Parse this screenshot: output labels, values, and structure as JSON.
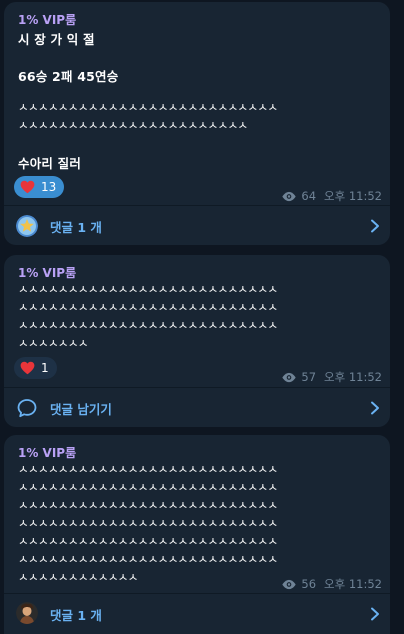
{
  "posts": [
    {
      "channel": "1% VIP룸",
      "lines": [
        "시 장 가 익 절",
        "66승 2패 45연승",
        "수아리 질러"
      ],
      "ah_lines": [
        "ㅅㅅㅅㅅㅅㅅㅅㅅㅅㅅㅅㅅㅅㅅㅅㅅㅅㅅㅅㅅㅅㅅㅅㅅㅅㅅ",
        "ㅅㅅㅅㅅㅅㅅㅅㅅㅅㅅㅅㅅㅅㅅㅅㅅㅅㅅㅅㅅㅅㅅㅅ"
      ],
      "reaction_count": "13",
      "views": "64",
      "time": "오후 11:52",
      "comments_label": "댓글 1 개"
    },
    {
      "channel": "1% VIP룸",
      "ah_lines": [
        "ㅅㅅㅅㅅㅅㅅㅅㅅㅅㅅㅅㅅㅅㅅㅅㅅㅅㅅㅅㅅㅅㅅㅅㅅㅅㅅ",
        "ㅅㅅㅅㅅㅅㅅㅅㅅㅅㅅㅅㅅㅅㅅㅅㅅㅅㅅㅅㅅㅅㅅㅅㅅㅅㅅ",
        "ㅅㅅㅅㅅㅅㅅㅅㅅㅅㅅㅅㅅㅅㅅㅅㅅㅅㅅㅅㅅㅅㅅㅅㅅㅅㅅ",
        "ㅅㅅㅅㅅㅅㅅㅅ"
      ],
      "reaction_count": "1",
      "views": "57",
      "time": "오후 11:52",
      "comments_label": "댓글 남기기"
    },
    {
      "channel": "1% VIP룸",
      "ah_lines": [
        "ㅅㅅㅅㅅㅅㅅㅅㅅㅅㅅㅅㅅㅅㅅㅅㅅㅅㅅㅅㅅㅅㅅㅅㅅㅅㅅ",
        "ㅅㅅㅅㅅㅅㅅㅅㅅㅅㅅㅅㅅㅅㅅㅅㅅㅅㅅㅅㅅㅅㅅㅅㅅㅅㅅ",
        "ㅅㅅㅅㅅㅅㅅㅅㅅㅅㅅㅅㅅㅅㅅㅅㅅㅅㅅㅅㅅㅅㅅㅅㅅㅅㅅ",
        "ㅅㅅㅅㅅㅅㅅㅅㅅㅅㅅㅅㅅㅅㅅㅅㅅㅅㅅㅅㅅㅅㅅㅅㅅㅅㅅ",
        "ㅅㅅㅅㅅㅅㅅㅅㅅㅅㅅㅅㅅㅅㅅㅅㅅㅅㅅㅅㅅㅅㅅㅅㅅㅅㅅ",
        "ㅅㅅㅅㅅㅅㅅㅅㅅㅅㅅㅅㅅㅅㅅㅅㅅㅅㅅㅅㅅㅅㅅㅅㅅㅅㅅ",
        "ㅅㅅㅅㅅㅅㅅㅅㅅㅅㅅㅅㅅ"
      ],
      "views": "56",
      "time": "오후 11:52",
      "comments_label": "댓글 1 개"
    }
  ],
  "icons": {
    "heart": "heart-icon",
    "eye": "eye-icon",
    "comment": "comment-bubble-icon",
    "chevron": "chevron-right-icon"
  },
  "colors": {
    "background": "#0e1621",
    "card": "#182533",
    "channel_name": "#b9a1f5",
    "link": "#6ab2f2",
    "reaction_active": "#3a8ed1",
    "meta": "#6f8396"
  }
}
